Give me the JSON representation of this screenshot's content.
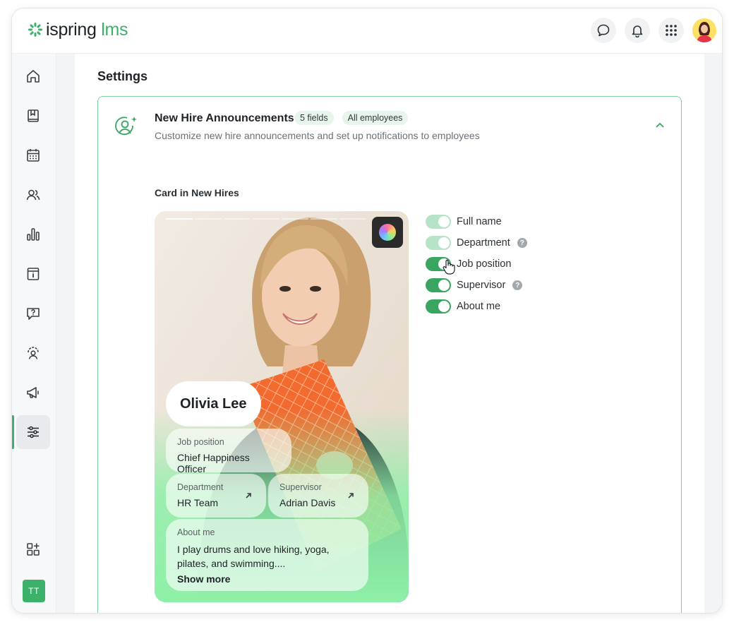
{
  "app": {
    "logo_main": "ispring",
    "logo_accent": " lms"
  },
  "topbar": {
    "icons": [
      "chat-icon",
      "bell-icon",
      "apps-grid-icon"
    ]
  },
  "sidebar": {
    "items": [
      "home-icon",
      "book-icon",
      "calendar-icon",
      "users-icon",
      "chart-icon",
      "info-icon",
      "question-icon",
      "people-gear-icon",
      "megaphone-icon",
      "sliders-icon"
    ],
    "active": "sliders-icon",
    "bottom_icon": "add-widget-icon",
    "user_initials": "TT",
    "accent": "#3db169"
  },
  "page": {
    "title": "Settings"
  },
  "panel": {
    "title": "New Hire Announcements",
    "tags": [
      "5 fields",
      "All employees"
    ],
    "subtitle": "Customize new hire announcements and set up notifications to employees",
    "section_label": "Card in New Hires"
  },
  "card": {
    "name": "Olivia Lee",
    "job_label": "Job position",
    "job_value": "Chief Happiness Officer",
    "dept_label": "Department",
    "dept_value": "HR Team",
    "supervisor_label": "Supervisor",
    "supervisor_value": "Adrian Davis",
    "about_label": "About me",
    "about_value": "I play drums and love hiking, yoga, pilates, and swimming....",
    "show_more": "Show more",
    "gradient_color": "#8ef0a8"
  },
  "toggles": [
    {
      "label": "Full name",
      "state": "on-disabled",
      "help": false
    },
    {
      "label": "Department",
      "state": "on-disabled",
      "help": true
    },
    {
      "label": "Job position",
      "state": "on",
      "help": false
    },
    {
      "label": "Supervisor",
      "state": "on",
      "help": true
    },
    {
      "label": "About me",
      "state": "on",
      "help": false
    }
  ],
  "help_glyph": "?"
}
